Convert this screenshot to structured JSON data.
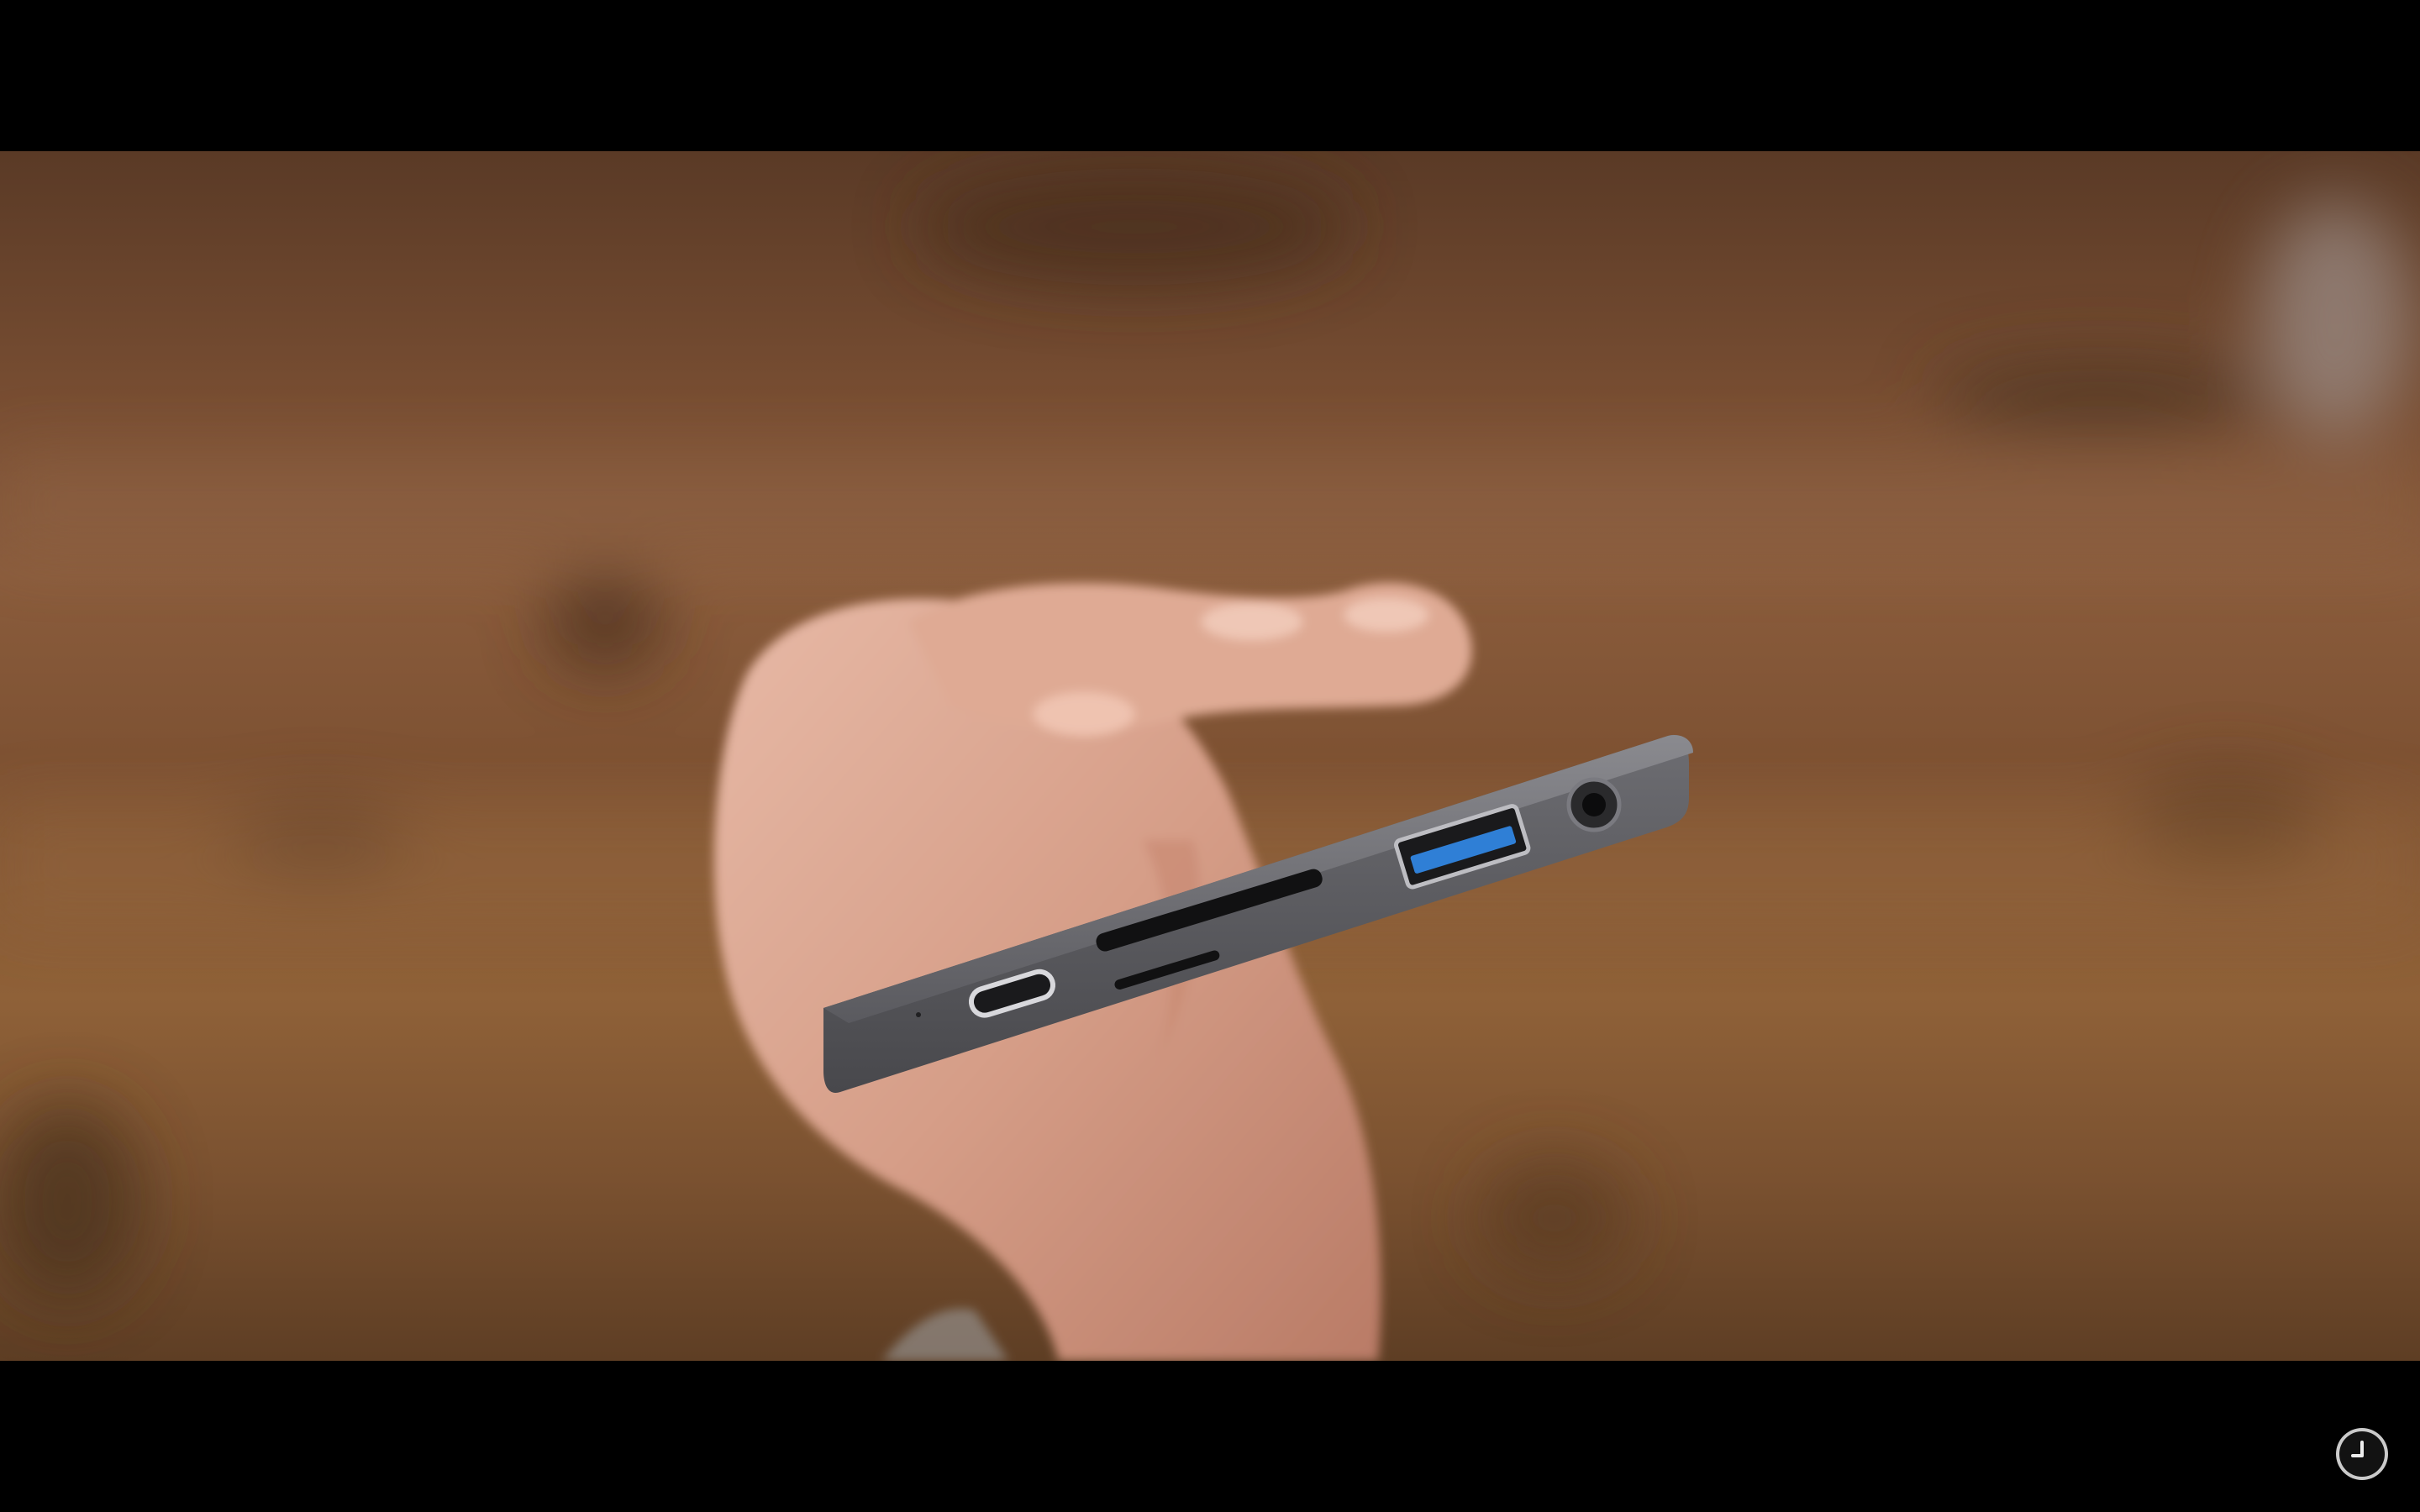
{
  "player": {
    "video_description_visible": false
  },
  "controls": {
    "history_icon": "clock-icon"
  },
  "colors": {
    "letterbox": "#000000",
    "usb_port_blue": "#2f7fd6",
    "hub_body": "#5f5f63"
  }
}
